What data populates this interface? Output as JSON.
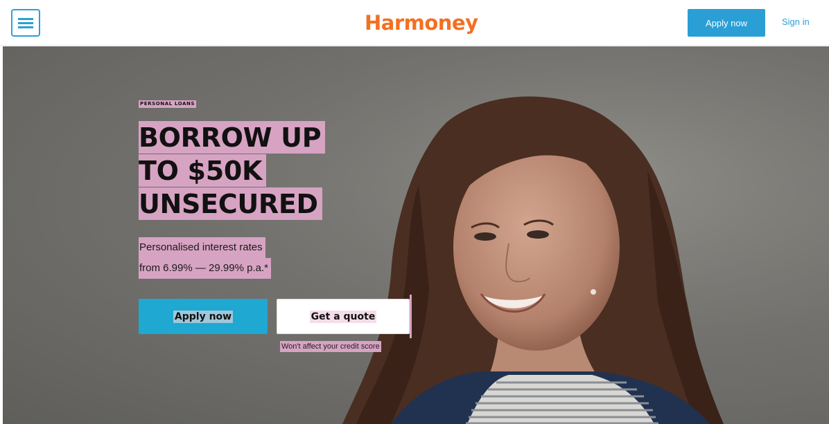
{
  "header": {
    "menu_icon": "hamburger-menu-icon",
    "logo_text": "Harmoney",
    "apply_label": "Apply now",
    "signin_label": "Sign in",
    "brand_color": "#f37021",
    "accent_color": "#2a9fd6"
  },
  "hero": {
    "eyebrow": "PERSONAL LOANS",
    "headline_lines": [
      "BORROW UP",
      "TO $50K",
      "UNSECURED"
    ],
    "subtext_lines": [
      "Personalised interest rates",
      "from 6.99% — 29.99% p.a.*"
    ],
    "apply_label": "Apply now",
    "quote_label": "Get a quote",
    "note": "Won't affect your credit score",
    "highlight_color": "#d7a3c3"
  }
}
